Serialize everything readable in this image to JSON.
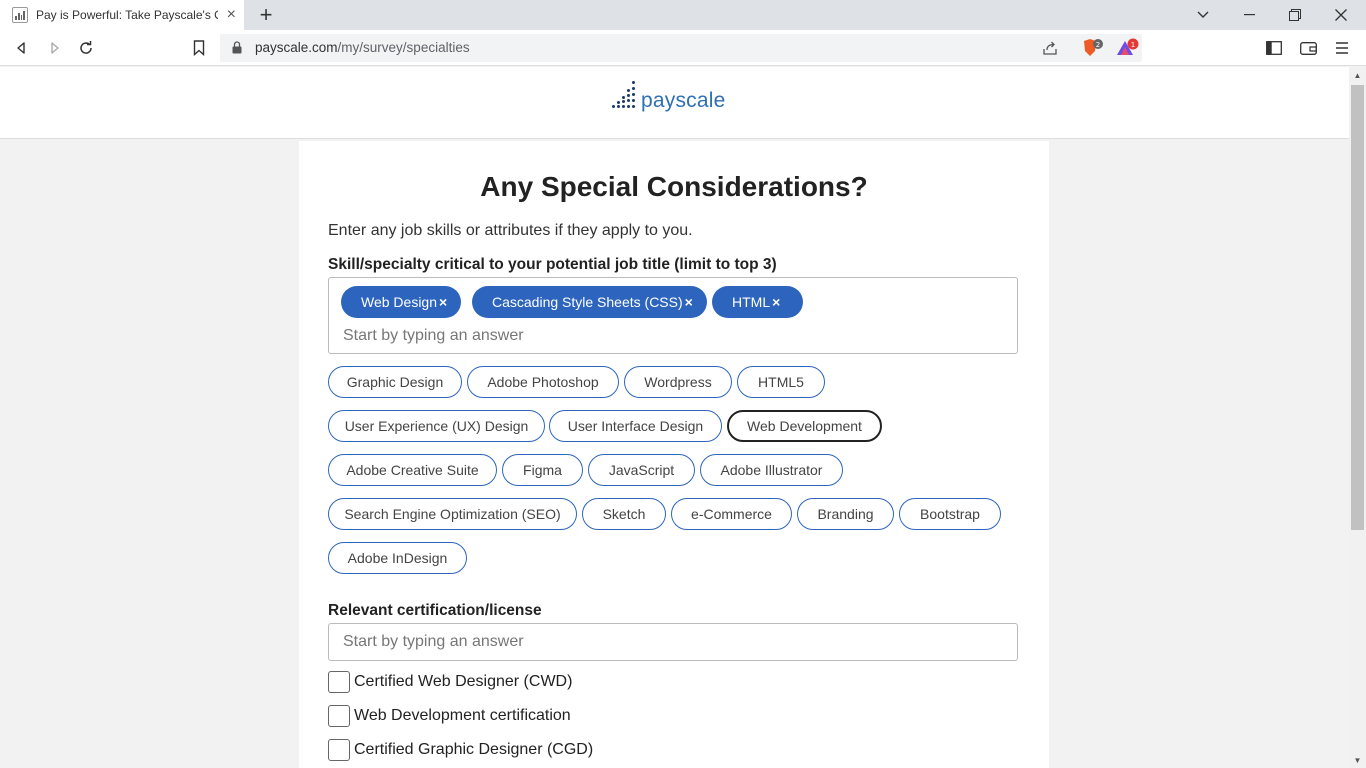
{
  "browser": {
    "tab_title": "Pay is Powerful: Take Payscale's O",
    "url_host": "payscale.com",
    "url_path": "/my/survey/specialties",
    "brave_badge_count": "2",
    "rewards_badge_count": "1"
  },
  "site": {
    "logo_text": "payscale"
  },
  "page": {
    "title": "Any Special Considerations?",
    "intro": "Enter any job skills or attributes if they apply to you."
  },
  "skills": {
    "label": "Skill/specialty critical to your potential job title (limit to top 3)",
    "placeholder": "Start by typing an answer",
    "selected": [
      "Web Design",
      "Cascading Style Sheets (CSS)",
      "HTML"
    ],
    "remove_glyph": "×",
    "suggestions": [
      "Graphic Design",
      "Adobe Photoshop",
      "Wordpress",
      "HTML5",
      "User Experience (UX) Design",
      "User Interface Design",
      "Web Development",
      "Adobe Creative Suite",
      "Figma",
      "JavaScript",
      "Adobe Illustrator",
      "Search Engine Optimization (SEO)",
      "Sketch",
      "e-Commerce",
      "Branding",
      "Bootstrap",
      "Adobe InDesign"
    ]
  },
  "certification": {
    "label": "Relevant certification/license",
    "placeholder": "Start by typing an answer",
    "options": [
      {
        "label": "Certified Web Designer (CWD)",
        "checked": false
      },
      {
        "label": "Web Development certification",
        "checked": false
      },
      {
        "label": "Certified Graphic Designer (CGD)",
        "checked": false
      }
    ]
  },
  "colors": {
    "accent": "#2d65be",
    "logo_dots": "#1a3a6b",
    "logo_text": "#2f6fb5"
  },
  "icons": [
    "back-icon",
    "forward-icon",
    "reload-icon",
    "bookmark-icon",
    "lock-icon",
    "share-icon",
    "brave-shield-icon",
    "brave-rewards-icon",
    "sidebar-icon",
    "wallet-icon",
    "menu-icon"
  ]
}
